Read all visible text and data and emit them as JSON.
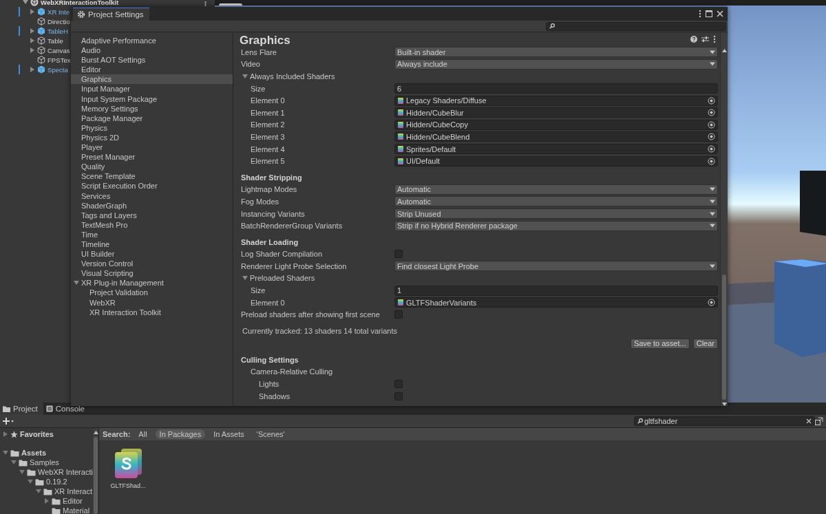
{
  "hierarchy": {
    "root": {
      "label": "WebXRInteractionToolkit",
      "expanded": true
    },
    "items": [
      {
        "label": "XR Inte",
        "prefab": true,
        "expanded": false
      },
      {
        "label": "Directio",
        "prefab": false
      },
      {
        "label": "TableH",
        "prefab": true,
        "expanded": false
      },
      {
        "label": "Table",
        "prefab": false,
        "expanded": false
      },
      {
        "label": "Canvas",
        "prefab": false,
        "expanded": false
      },
      {
        "label": "FPSTex",
        "prefab": false
      },
      {
        "label": "Specta",
        "prefab": true,
        "expanded": false
      }
    ]
  },
  "settings_window": {
    "title": "Project Settings",
    "categories": [
      {
        "label": "Adaptive Performance",
        "selected": false
      },
      {
        "label": "Audio",
        "selected": false
      },
      {
        "label": "Burst AOT Settings",
        "selected": false
      },
      {
        "label": "Editor",
        "selected": false
      },
      {
        "label": "Graphics",
        "selected": true
      },
      {
        "label": "Input Manager",
        "selected": false
      },
      {
        "label": "Input System Package",
        "selected": false
      },
      {
        "label": "Memory Settings",
        "selected": false
      },
      {
        "label": "Package Manager",
        "selected": false
      },
      {
        "label": "Physics",
        "selected": false
      },
      {
        "label": "Physics 2D",
        "selected": false
      },
      {
        "label": "Player",
        "selected": false
      },
      {
        "label": "Preset Manager",
        "selected": false
      },
      {
        "label": "Quality",
        "selected": false
      },
      {
        "label": "Scene Template",
        "selected": false
      },
      {
        "label": "Script Execution Order",
        "selected": false
      },
      {
        "label": "Services",
        "selected": false
      },
      {
        "label": "ShaderGraph",
        "selected": false
      },
      {
        "label": "Tags and Layers",
        "selected": false
      },
      {
        "label": "TextMesh Pro",
        "selected": false
      },
      {
        "label": "Time",
        "selected": false
      },
      {
        "label": "Timeline",
        "selected": false
      },
      {
        "label": "UI Builder",
        "selected": false
      },
      {
        "label": "Version Control",
        "selected": false
      },
      {
        "label": "Visual Scripting",
        "selected": false
      },
      {
        "label": "XR Plug-in Management",
        "selected": false,
        "expanded": true,
        "children": [
          {
            "label": "Project Validation",
            "selected": false
          },
          {
            "label": "WebXR",
            "selected": false
          },
          {
            "label": "XR Interaction Toolkit",
            "selected": false
          }
        ]
      }
    ],
    "page_title": "Graphics",
    "rows": [
      {
        "kind": "dropdown",
        "label": "Lens Flare",
        "value": "Built-in shader"
      },
      {
        "kind": "dropdown",
        "label": "Video",
        "value": "Always include"
      },
      {
        "kind": "foldout",
        "label": "Always Included Shaders",
        "expanded": true,
        "children": [
          {
            "kind": "int",
            "label": "Size",
            "value": "6"
          },
          {
            "kind": "object",
            "label": "Element 0",
            "value": "Legacy Shaders/Diffuse"
          },
          {
            "kind": "object",
            "label": "Element 1",
            "value": "Hidden/CubeBlur"
          },
          {
            "kind": "object",
            "label": "Element 2",
            "value": "Hidden/CubeCopy"
          },
          {
            "kind": "object",
            "label": "Element 3",
            "value": "Hidden/CubeBlend"
          },
          {
            "kind": "object",
            "label": "Element 4",
            "value": "Sprites/Default"
          },
          {
            "kind": "object",
            "label": "Element 5",
            "value": "UI/Default"
          }
        ]
      },
      {
        "kind": "header",
        "label": "Shader Stripping"
      },
      {
        "kind": "dropdown",
        "label": "Lightmap Modes",
        "value": "Automatic"
      },
      {
        "kind": "dropdown",
        "label": "Fog Modes",
        "value": "Automatic"
      },
      {
        "kind": "dropdown",
        "label": "Instancing Variants",
        "value": "Strip Unused"
      },
      {
        "kind": "dropdown",
        "label": "BatchRendererGroup Variants",
        "value": "Strip if no Hybrid Renderer package"
      },
      {
        "kind": "header",
        "label": "Shader Loading"
      },
      {
        "kind": "checkbox",
        "label": "Log Shader Compilation",
        "checked": false
      },
      {
        "kind": "dropdown",
        "label": "Renderer Light Probe Selection",
        "value": "Find closest Light Probe"
      },
      {
        "kind": "foldout",
        "label": "Preloaded Shaders",
        "expanded": true,
        "children": [
          {
            "kind": "int",
            "label": "Size",
            "value": "1"
          },
          {
            "kind": "object",
            "label": "Element 0",
            "value": "GLTFShaderVariants"
          }
        ]
      },
      {
        "kind": "checkbox",
        "label": "Preload shaders after showing first scene",
        "checked": false
      },
      {
        "kind": "note",
        "label": "Currently tracked: 13 shaders 14 total variants"
      },
      {
        "kind": "buttons",
        "buttons": [
          "Save to asset...",
          "Clear"
        ]
      },
      {
        "kind": "header",
        "label": "Culling Settings"
      },
      {
        "kind": "group",
        "label": "Camera-Relative Culling",
        "children": [
          {
            "kind": "checkbox",
            "label": "Lights",
            "checked": false
          },
          {
            "kind": "checkbox",
            "label": "Shadows",
            "checked": false
          }
        ]
      }
    ]
  },
  "project_panel": {
    "tabs": [
      {
        "label": "Project",
        "selected": true
      },
      {
        "label": "Console",
        "selected": false
      }
    ],
    "search": {
      "value": "gltfshader"
    },
    "tree": [
      {
        "kind": "favorites",
        "label": "Favorites",
        "expanded": false
      },
      {
        "kind": "folder",
        "label": "Assets",
        "expanded": true,
        "children": [
          {
            "kind": "folder",
            "label": "Samples",
            "expanded": true,
            "children": [
              {
                "kind": "folder",
                "label": "WebXR Interacti",
                "expanded": true,
                "children": [
                  {
                    "kind": "folder",
                    "label": "0.19.2",
                    "expanded": true,
                    "children": [
                      {
                        "kind": "folder",
                        "label": "XR Interact",
                        "expanded": true,
                        "children": [
                          {
                            "kind": "folder",
                            "label": "Editor",
                            "expanded": false
                          },
                          {
                            "kind": "folder",
                            "label": "Material"
                          }
                        ]
                      }
                    ]
                  }
                ]
              }
            ]
          }
        ]
      }
    ],
    "filter_label": "Search:",
    "filters": [
      {
        "label": "All",
        "selected": false
      },
      {
        "label": "In Packages",
        "selected": true
      },
      {
        "label": "In Assets",
        "selected": false
      },
      {
        "label": "'Scenes'",
        "selected": false
      }
    ],
    "assets": [
      {
        "label": "GLTFShad...",
        "kind": "shader-variants"
      }
    ]
  }
}
